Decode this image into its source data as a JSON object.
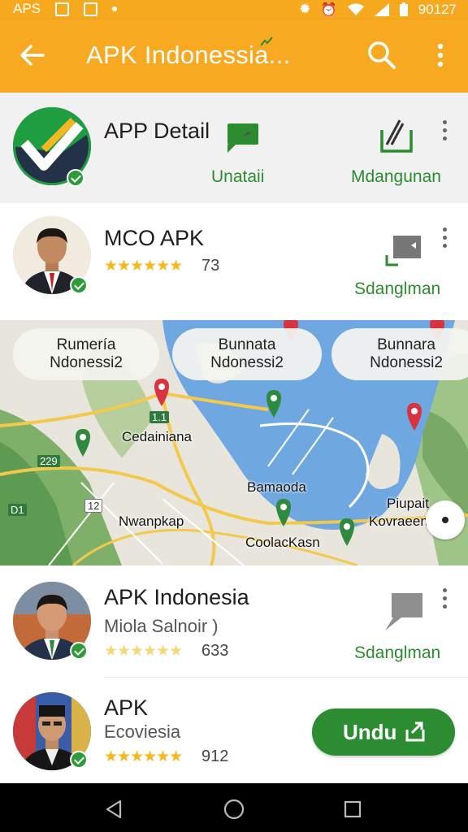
{
  "status_bar": {
    "left_text": "APS",
    "time": "90127"
  },
  "app_bar": {
    "title": "APK Indonessia..."
  },
  "items": [
    {
      "name": "APP Detail",
      "actions": [
        {
          "label": "Unataii",
          "icon": "chat-bubble-icon"
        },
        {
          "label": "Mdangunan",
          "icon": "edit-box-icon"
        }
      ]
    },
    {
      "name": "MCO APK",
      "rating": "73",
      "action_label": "Sdanglman",
      "icon": "chat-bubble-icon"
    },
    {
      "name": "APK Indonesia",
      "subtitle": "Miola Salnoir )",
      "rating": "633",
      "action_label": "Sdanglman",
      "icon": "chat-bubble-icon"
    },
    {
      "name": "APK",
      "subtitle": "Ecoviesia",
      "rating": "912",
      "button_label": "Undu"
    }
  ],
  "map": {
    "chips": [
      {
        "line1": "Rumería",
        "line2": "Ndonessi2"
      },
      {
        "line1": "Bunnata",
        "line2": "Ndonessi2"
      },
      {
        "line1": "Bunnara",
        "line2": "Ndonessi2"
      }
    ],
    "places": {
      "cedainiana": "Cedainiana",
      "bamaoda": "Bamaoda",
      "nwanpkap": "Nwanpkap",
      "coolackasn": "CoolacKasn",
      "piupait_1": "Piupait",
      "piupait_2": "Kovraeenie"
    },
    "road_signs": {
      "s1": "229",
      "s2": "D1",
      "s3": "12",
      "s4": "1.1"
    }
  },
  "colors": {
    "app_bar": "#f7a921",
    "accent_green": "#2c8c31",
    "star": "#f4b71c"
  }
}
